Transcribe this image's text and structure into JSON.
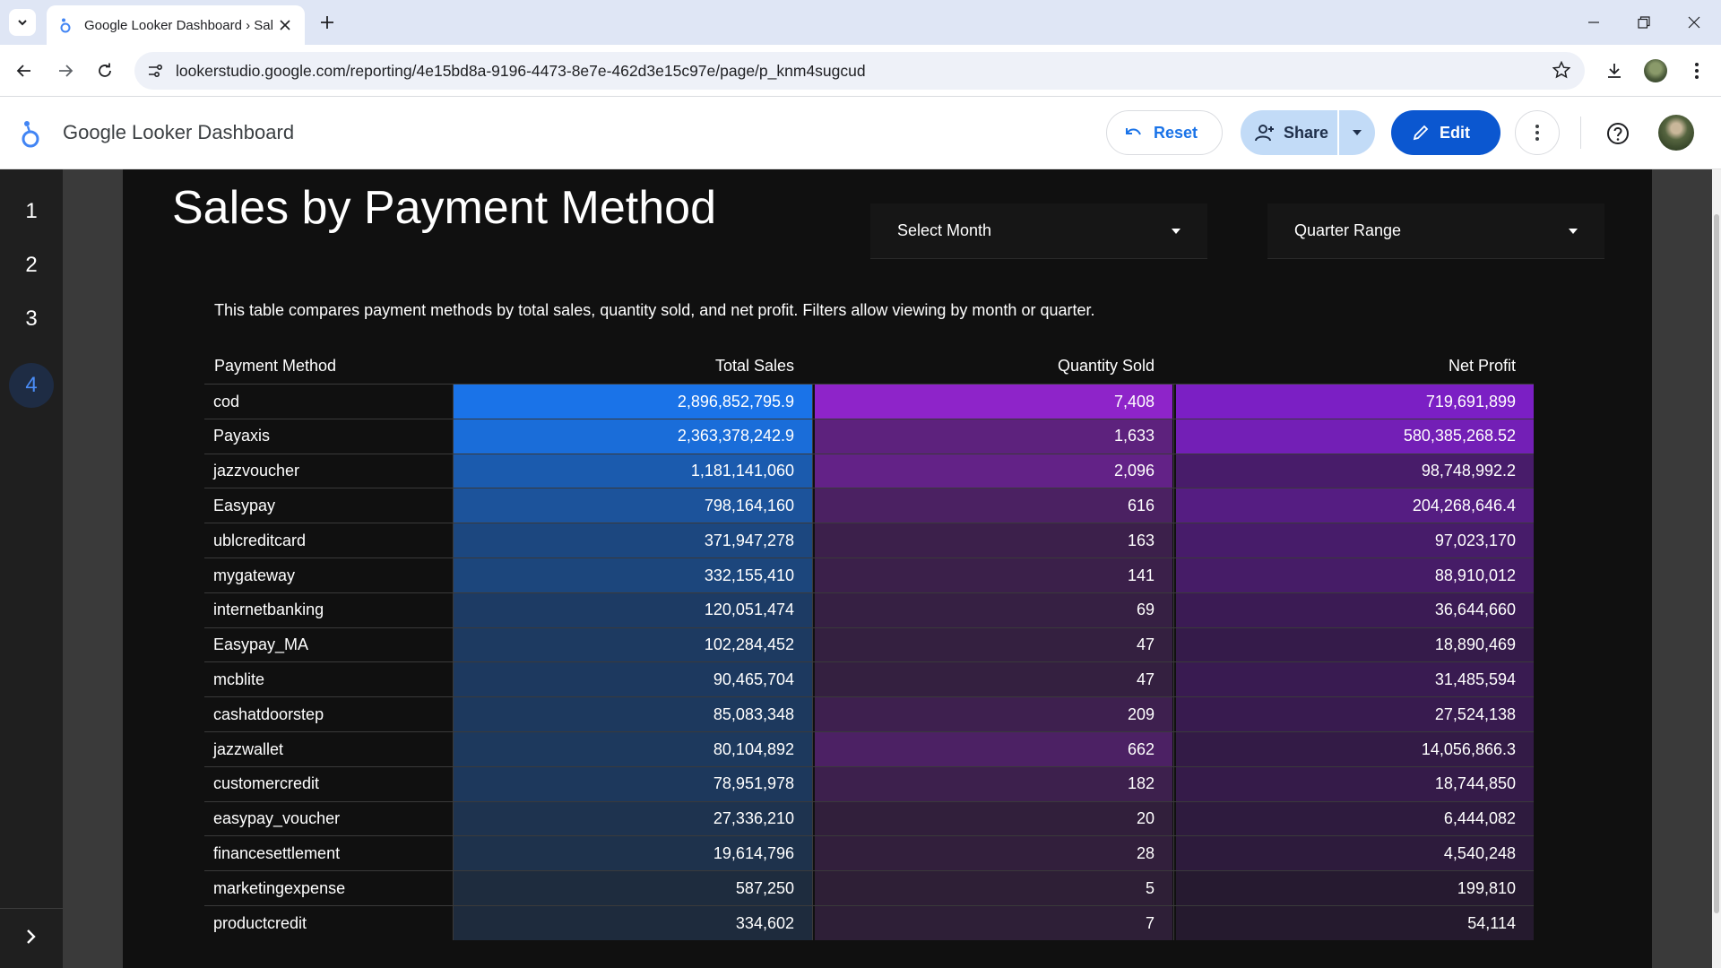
{
  "browser": {
    "tab_title": "Google Looker Dashboard › Sal",
    "url": "lookerstudio.google.com/reporting/4e15bd8a-9196-4473-8e7e-462d3e15c97e/page/p_knm4sugcud"
  },
  "app": {
    "title": "Google Looker Dashboard",
    "reset_label": "Reset",
    "share_label": "Share",
    "edit_label": "Edit"
  },
  "pages": [
    "1",
    "2",
    "3",
    "4"
  ],
  "active_page": "4",
  "report": {
    "title": "Sales by Payment Method",
    "filter_month": "Select Month",
    "filter_quarter": "Quarter Range",
    "description": "This table compares payment methods by total sales, quantity sold, and net profit. Filters allow viewing by month or quarter."
  },
  "table": {
    "headers": [
      "Payment Method",
      "Total Sales",
      "Quantity Sold",
      "Net Profit"
    ],
    "rows": [
      {
        "method": "cod",
        "sales": "2,896,852,795.9",
        "qty": "7,408",
        "profit": "719,691,899"
      },
      {
        "method": "Payaxis",
        "sales": "2,363,378,242.9",
        "qty": "1,633",
        "profit": "580,385,268.52"
      },
      {
        "method": "jazzvoucher",
        "sales": "1,181,141,060",
        "qty": "2,096",
        "profit": "98,748,992.2"
      },
      {
        "method": "Easypay",
        "sales": "798,164,160",
        "qty": "616",
        "profit": "204,268,646.4"
      },
      {
        "method": "ublcreditcard",
        "sales": "371,947,278",
        "qty": "163",
        "profit": "97,023,170"
      },
      {
        "method": "mygateway",
        "sales": "332,155,410",
        "qty": "141",
        "profit": "88,910,012"
      },
      {
        "method": "internetbanking",
        "sales": "120,051,474",
        "qty": "69",
        "profit": "36,644,660"
      },
      {
        "method": "Easypay_MA",
        "sales": "102,284,452",
        "qty": "47",
        "profit": "18,890,469"
      },
      {
        "method": "mcblite",
        "sales": "90,465,704",
        "qty": "47",
        "profit": "31,485,594"
      },
      {
        "method": "cashatdoorstep",
        "sales": "85,083,348",
        "qty": "209",
        "profit": "27,524,138"
      },
      {
        "method": "jazzwallet",
        "sales": "80,104,892",
        "qty": "662",
        "profit": "14,056,866.3"
      },
      {
        "method": "customercredit",
        "sales": "78,951,978",
        "qty": "182",
        "profit": "18,744,850"
      },
      {
        "method": "easypay_voucher",
        "sales": "27,336,210",
        "qty": "20",
        "profit": "6,444,082"
      },
      {
        "method": "financesettlement",
        "sales": "19,614,796",
        "qty": "28",
        "profit": "4,540,248"
      },
      {
        "method": "marketingexpense",
        "sales": "587,250",
        "qty": "5",
        "profit": "199,810"
      },
      {
        "method": "productcredit",
        "sales": "334,602",
        "qty": "7",
        "profit": "54,114"
      }
    ]
  },
  "colors": {
    "sales_high": "#1a73e8",
    "sales_low": "#1e2a3a",
    "qty_high": "#8e24c9",
    "qty_low": "#2a1f30",
    "profit_high": "#7b1fc4",
    "profit_low": "#241a2c"
  },
  "icons": [
    "tab-list-icon",
    "looker-favicon",
    "close-icon",
    "plus-icon",
    "minimize-icon",
    "restore-icon",
    "close-window-icon",
    "back-icon",
    "forward-icon",
    "reload-icon",
    "site-info-icon",
    "star-icon",
    "download-icon",
    "kebab-icon",
    "undo-icon",
    "person-add-icon",
    "dropdown-icon",
    "pencil-icon",
    "more-vert-icon",
    "help-icon",
    "chevron-right-icon"
  ]
}
